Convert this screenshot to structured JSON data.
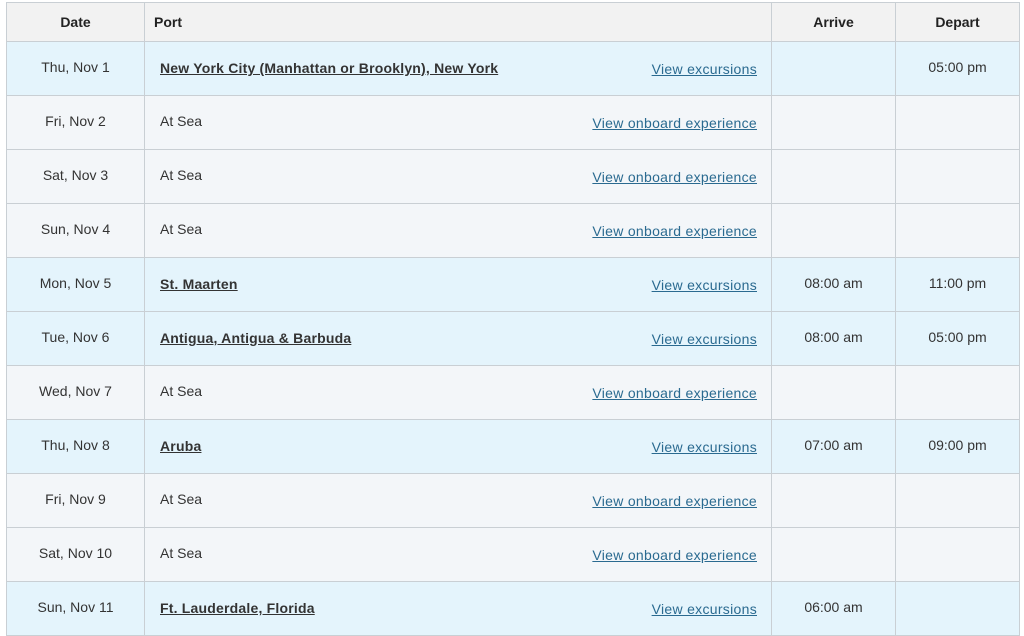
{
  "header": {
    "date": "Date",
    "port": "Port",
    "arrive": "Arrive",
    "depart": "Depart"
  },
  "rows": [
    {
      "date": "Thu, Nov 1",
      "port": "New York City (Manhattan or Brooklyn), New York",
      "link": "View excursions",
      "arrive": "",
      "depart": "05:00 pm"
    },
    {
      "date": "Fri, Nov 2",
      "port": "At Sea",
      "link": "View onboard experience",
      "arrive": "",
      "depart": ""
    },
    {
      "date": "Sat, Nov 3",
      "port": "At Sea",
      "link": "View onboard experience",
      "arrive": "",
      "depart": ""
    },
    {
      "date": "Sun, Nov 4",
      "port": "At Sea",
      "link": "View onboard experience",
      "arrive": "",
      "depart": ""
    },
    {
      "date": "Mon, Nov 5",
      "port": "St. Maarten",
      "link": "View excursions",
      "arrive": "08:00 am",
      "depart": "11:00 pm"
    },
    {
      "date": "Tue, Nov 6",
      "port": "Antigua, Antigua & Barbuda",
      "link": "View excursions",
      "arrive": "08:00 am",
      "depart": "05:00 pm"
    },
    {
      "date": "Wed, Nov 7",
      "port": "At Sea",
      "link": "View onboard experience",
      "arrive": "",
      "depart": ""
    },
    {
      "date": "Thu, Nov 8",
      "port": "Aruba",
      "link": "View excursions",
      "arrive": "07:00 am",
      "depart": "09:00 pm"
    },
    {
      "date": "Fri, Nov 9",
      "port": "At Sea",
      "link": "View onboard experience",
      "arrive": "",
      "depart": ""
    },
    {
      "date": "Sat, Nov 10",
      "port": "At Sea",
      "link": "View onboard experience",
      "arrive": "",
      "depart": ""
    },
    {
      "date": "Sun, Nov 11",
      "port": "Ft. Lauderdale, Florida",
      "link": "View excursions",
      "arrive": "06:00 am",
      "depart": ""
    }
  ],
  "colors": {
    "port_row_bg": "#e4f4fc",
    "sea_row_bg": "#f3f6f9",
    "header_bg": "#f2f2f2",
    "link": "#2a6a90",
    "border": "#c9cfd4"
  }
}
